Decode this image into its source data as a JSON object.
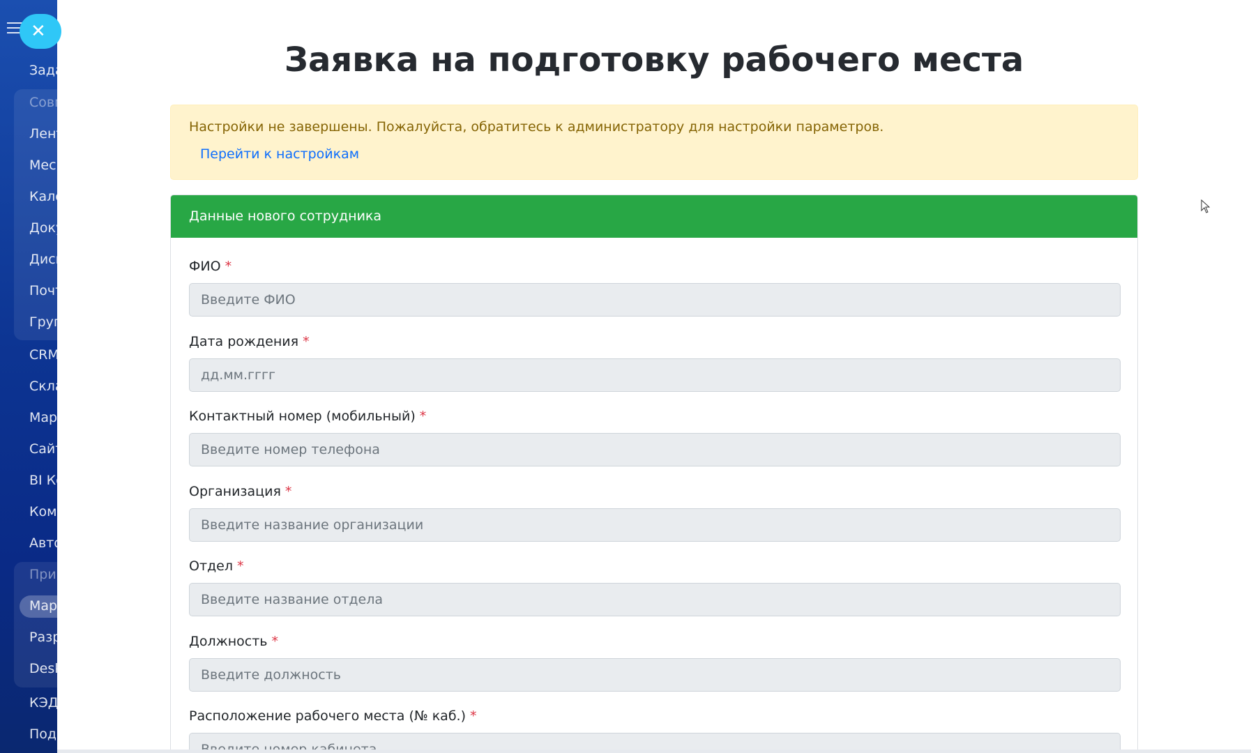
{
  "sidebar": {
    "items": [
      {
        "label": "Зада",
        "muted": false
      },
      {
        "label": "Совм",
        "muted": true
      },
      {
        "label": "Лент",
        "muted": false
      },
      {
        "label": "Мес",
        "muted": false
      },
      {
        "label": "Кале",
        "muted": false
      },
      {
        "label": "Доку",
        "muted": false
      },
      {
        "label": "Диск",
        "muted": false
      },
      {
        "label": "Почт",
        "muted": false
      },
      {
        "label": "Груп",
        "muted": false
      },
      {
        "label": "CRM",
        "muted": false
      },
      {
        "label": "Скла",
        "muted": false
      },
      {
        "label": "Мар",
        "muted": false
      },
      {
        "label": "Сайт",
        "muted": false
      },
      {
        "label": "BI Ко",
        "muted": false
      },
      {
        "label": "Комг",
        "muted": false
      },
      {
        "label": "Авто",
        "muted": false
      },
      {
        "label": "При",
        "muted": true
      },
      {
        "label": "Мар",
        "muted": false
      },
      {
        "label": "Разр",
        "muted": false
      },
      {
        "label": "Desk",
        "muted": false
      },
      {
        "label": "КЭД",
        "muted": false
      },
      {
        "label": "Подр",
        "muted": false
      }
    ]
  },
  "page": {
    "title": "Заявка на подготовку рабочего места"
  },
  "alert": {
    "text": "Настройки не завершены. Пожалуйста, обратитесь к администратору для настройки параметров.",
    "link": "Перейти к настройкам"
  },
  "card": {
    "header": "Данные нового сотрудника",
    "required_mark": "*",
    "fields": [
      {
        "label": "ФИО",
        "placeholder": "Введите ФИО"
      },
      {
        "label": "Дата рождения",
        "placeholder": "дд.мм.гггг"
      },
      {
        "label": "Контактный номер (мобильный)",
        "placeholder": "Введите номер телефона"
      },
      {
        "label": "Организация",
        "placeholder": "Введите название организации"
      },
      {
        "label": "Отдел",
        "placeholder": "Введите название отдела"
      },
      {
        "label": "Должность",
        "placeholder": "Введите должность"
      },
      {
        "label": "Расположение рабочего места (№ каб.)",
        "placeholder": "Введите номер кабинета"
      }
    ]
  },
  "colors": {
    "header_green": "#28a745",
    "alert_bg": "#fff3cd",
    "alert_text": "#856404",
    "link": "#0d6efd",
    "required": "#dc3545",
    "close_button": "#2fc7f7"
  }
}
